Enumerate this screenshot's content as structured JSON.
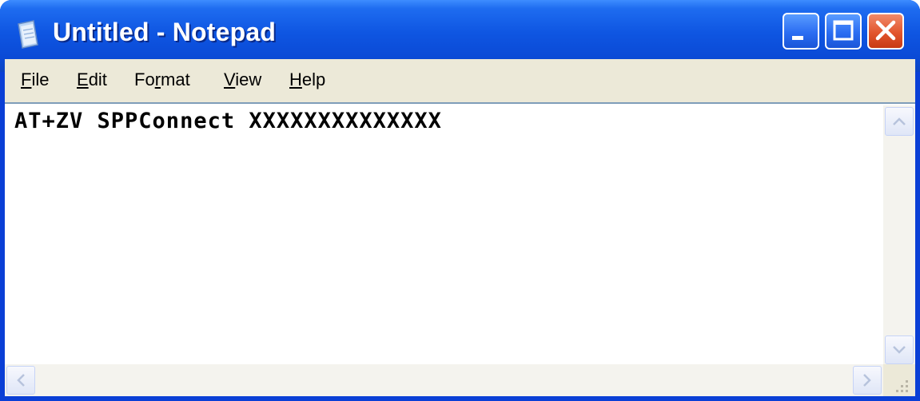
{
  "window": {
    "title": "Untitled - Notepad",
    "icons": {
      "app": "notepad-icon",
      "minimize": "minimize-icon",
      "maximize": "maximize-icon",
      "close": "close-icon"
    }
  },
  "menu": {
    "items": [
      {
        "first": "F",
        "rest": "ile"
      },
      {
        "first": "E",
        "rest": "dit"
      },
      {
        "first": "Fo",
        "u": "r",
        "rest": "mat"
      },
      {
        "first": "V",
        "rest": "iew"
      },
      {
        "first": "H",
        "rest": "elp"
      }
    ]
  },
  "editor": {
    "text": "AT+ZV SPPConnect XXXXXXXXXXXXXX"
  },
  "colors": {
    "titlebar": "#0a4ad6",
    "close_button": "#e2552d",
    "menubar": "#ece9d8"
  }
}
